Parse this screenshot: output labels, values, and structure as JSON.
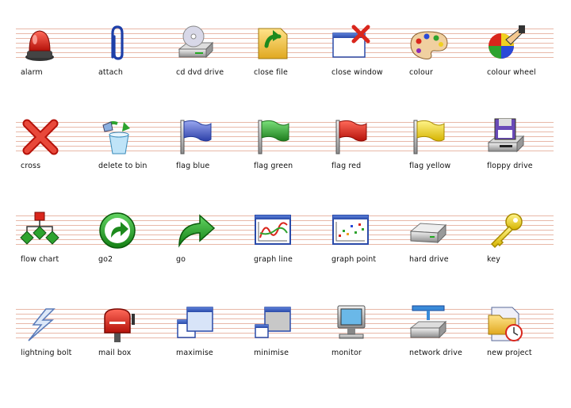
{
  "rows": [
    [
      "alarm",
      "attach",
      "cd dvd drive",
      "close file",
      "close window",
      "colour",
      "colour wheel"
    ],
    [
      "cross",
      "delete to bin",
      "flag blue",
      "flag green",
      "flag red",
      "flag yellow",
      "floppy drive"
    ],
    [
      "flow chart",
      "go2",
      "go",
      "graph line",
      "graph point",
      "hard drive",
      "key"
    ],
    [
      "lightning bolt",
      "mail box",
      "maximise",
      "minimise",
      "monitor",
      "network drive",
      "new project"
    ]
  ],
  "icons": [
    [
      "alarm-icon",
      "paperclip-icon",
      "cd-drive-icon",
      "close-file-icon",
      "close-window-icon",
      "palette-icon",
      "colour-wheel-icon"
    ],
    [
      "cross-icon",
      "recycle-bin-icon",
      "flag-blue-icon",
      "flag-green-icon",
      "flag-red-icon",
      "flag-yellow-icon",
      "floppy-drive-icon"
    ],
    [
      "flow-chart-icon",
      "go2-icon",
      "go-arrow-icon",
      "graph-line-icon",
      "graph-point-icon",
      "hard-drive-icon",
      "key-icon"
    ],
    [
      "lightning-bolt-icon",
      "mailbox-icon",
      "maximise-icon",
      "minimise-icon",
      "monitor-icon",
      "network-drive-icon",
      "new-project-icon"
    ]
  ],
  "colors": {
    "rule": "#e8b8a8",
    "red": "#d9261c",
    "blue": "#3a5fc8",
    "green": "#2ea32e",
    "yellow": "#f0d020"
  }
}
